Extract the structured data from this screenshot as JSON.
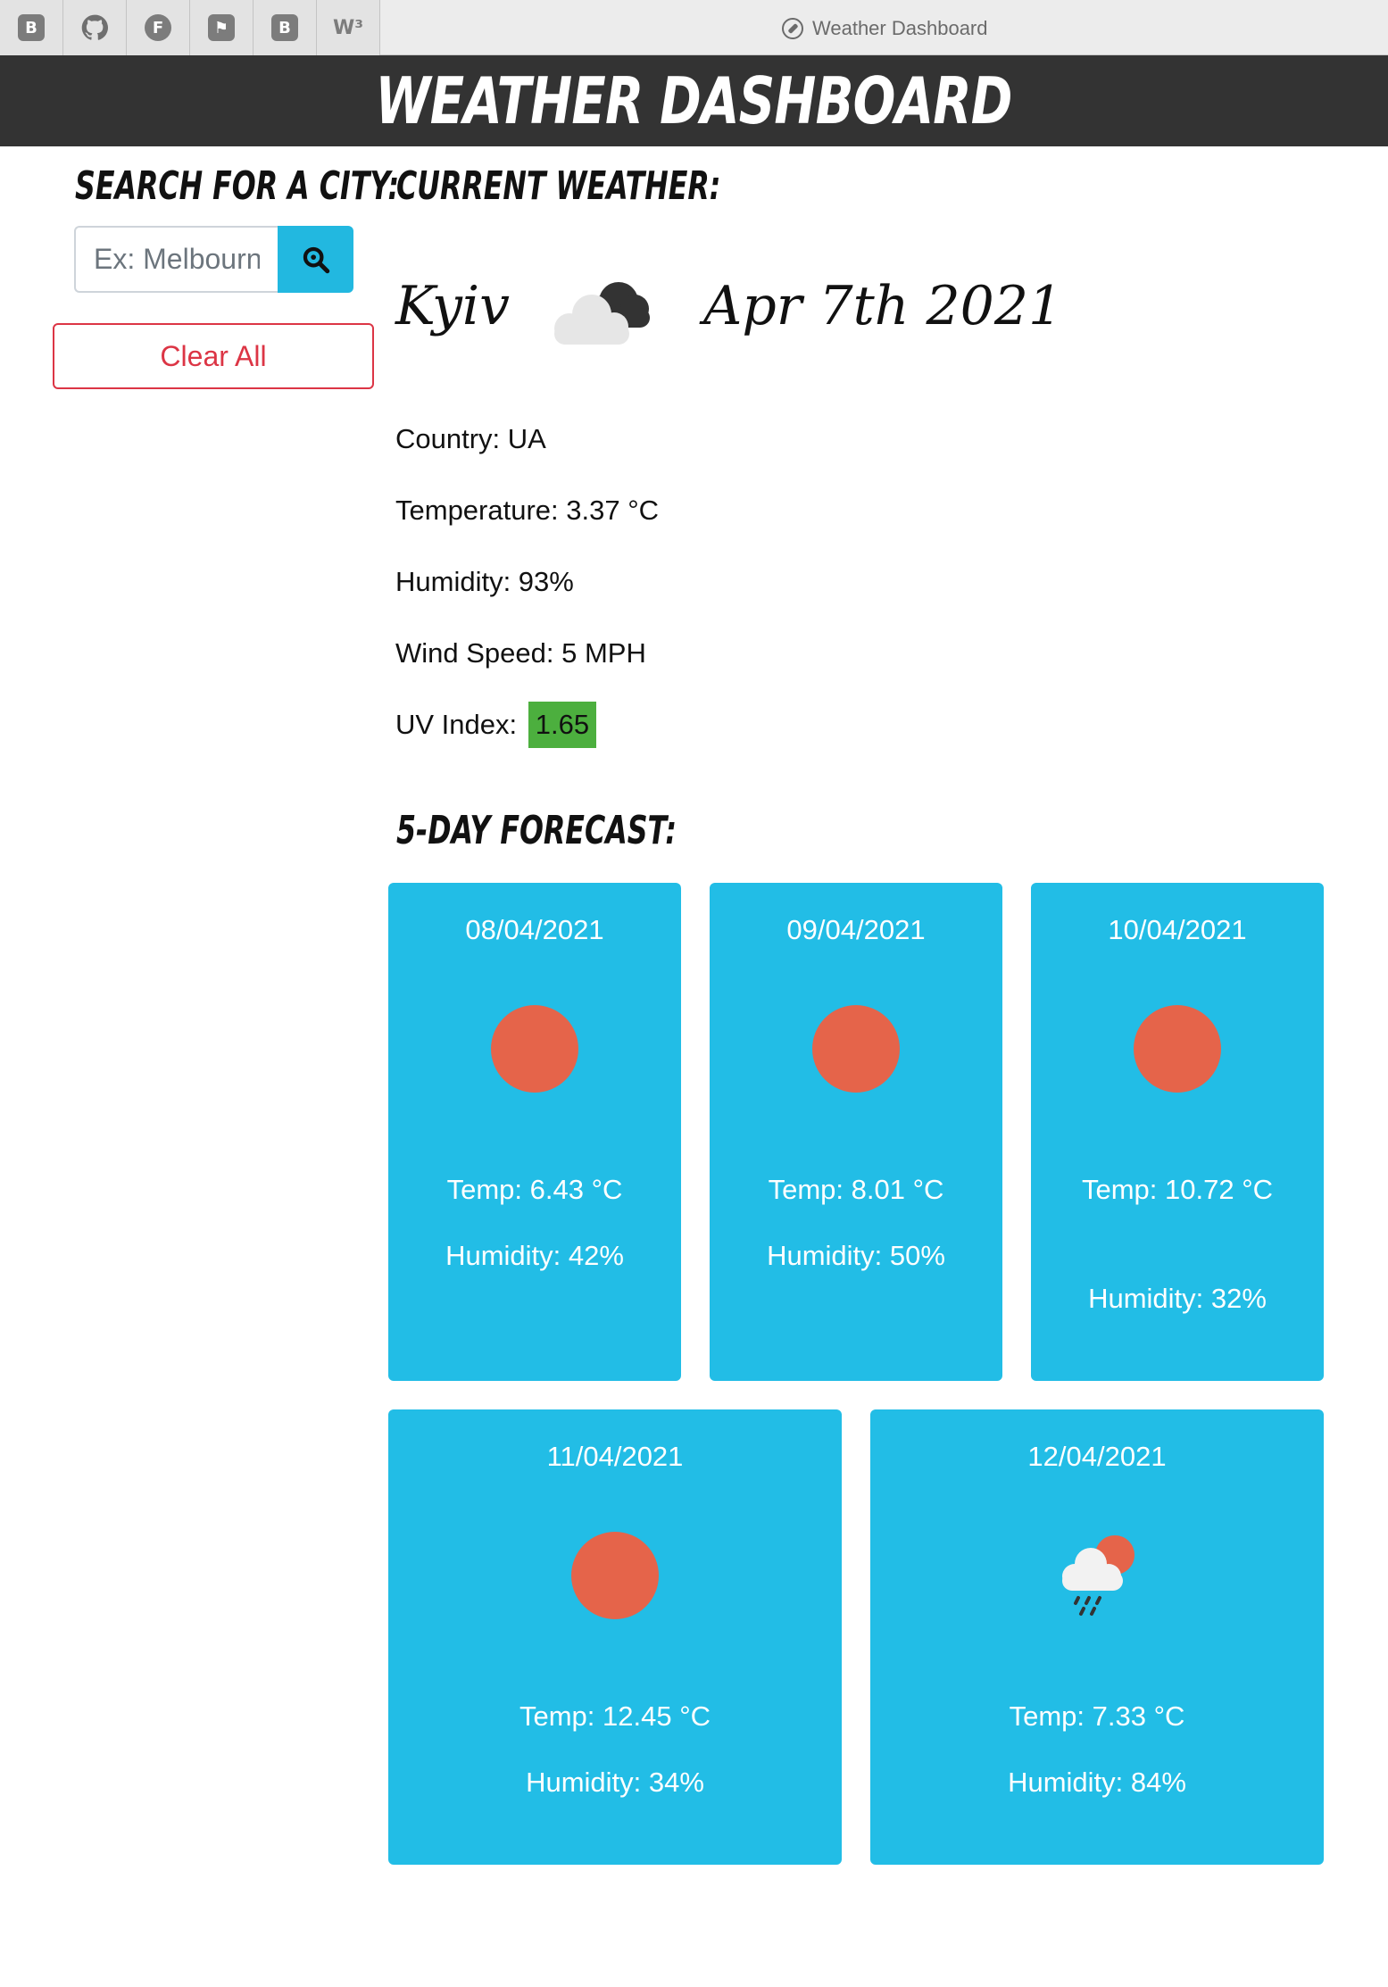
{
  "browser": {
    "bookmarks": [
      {
        "icon": "bootstrap-icon",
        "glyph": "B"
      },
      {
        "icon": "github-icon",
        "glyph": ""
      },
      {
        "icon": "f-icon",
        "glyph": "F"
      },
      {
        "icon": "flag-icon",
        "glyph": "⚑"
      },
      {
        "icon": "bootstrap-alt-icon",
        "glyph": "B"
      },
      {
        "icon": "w3-icon",
        "glyph": "W³"
      }
    ],
    "tab_title": "Weather Dashboard"
  },
  "header": {
    "title": "Weather Dashboard"
  },
  "search": {
    "title": "Search for a city:",
    "placeholder": "Ex: Melbourne",
    "clear_label": "Clear All"
  },
  "current": {
    "title": "Current Weather:",
    "city": "Kyiv",
    "date": "Apr 7th 2021",
    "icon": "cloud-night-icon",
    "country": "Country: UA",
    "temperature": "Temperature: 3.37 °C",
    "humidity": "Humidity: 93%",
    "wind": "Wind Speed: 5 MPH",
    "uv_label": "UV Index:",
    "uv_value": "1.65",
    "uv_color": "#4caf3e"
  },
  "forecast": {
    "title": "5-Day Forecast:",
    "days": [
      {
        "date": "08/04/2021",
        "icon": "sun-icon",
        "temp": "Temp: 6.43 °C",
        "humidity": "Humidity: 42%"
      },
      {
        "date": "09/04/2021",
        "icon": "sun-icon",
        "temp": "Temp: 8.01 °C",
        "humidity": "Humidity: 50%"
      },
      {
        "date": "10/04/2021",
        "icon": "sun-icon",
        "temp": "Temp: 10.72 °C",
        "humidity": "Humidity: 32%"
      },
      {
        "date": "11/04/2021",
        "icon": "sun-icon",
        "temp": "Temp: 12.45 °C",
        "humidity": "Humidity: 34%"
      },
      {
        "date": "12/04/2021",
        "icon": "rain-sun-icon",
        "temp": "Temp: 7.33 °C",
        "humidity": "Humidity: 84%"
      }
    ],
    "card_color": "#22bde6",
    "sun_color": "#e5644a"
  }
}
